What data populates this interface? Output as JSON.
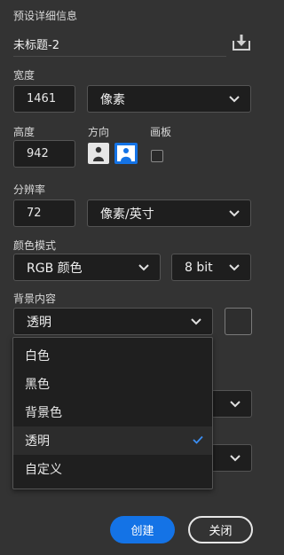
{
  "header": {
    "title": "预设详细信息"
  },
  "preset": {
    "name": "未标题-2"
  },
  "width": {
    "label": "宽度",
    "value": "1461",
    "unit": "像素"
  },
  "height": {
    "label": "高度",
    "value": "942"
  },
  "orientation": {
    "label": "方向",
    "selected": "landscape"
  },
  "artboard": {
    "label": "画板",
    "checked": false
  },
  "resolution": {
    "label": "分辨率",
    "value": "72",
    "unit": "像素/英寸"
  },
  "color_mode": {
    "label": "颜色模式",
    "mode": "RGB 颜色",
    "depth": "8 bit"
  },
  "background": {
    "label": "背景内容",
    "value": "透明",
    "options": [
      "白色",
      "黑色",
      "背景色",
      "透明",
      "自定义"
    ],
    "selected_index": 3
  },
  "buttons": {
    "create": "创建",
    "close": "关闭"
  },
  "colors": {
    "accent": "#1473e6",
    "panel": "#333333",
    "field": "#1e1e1e"
  }
}
